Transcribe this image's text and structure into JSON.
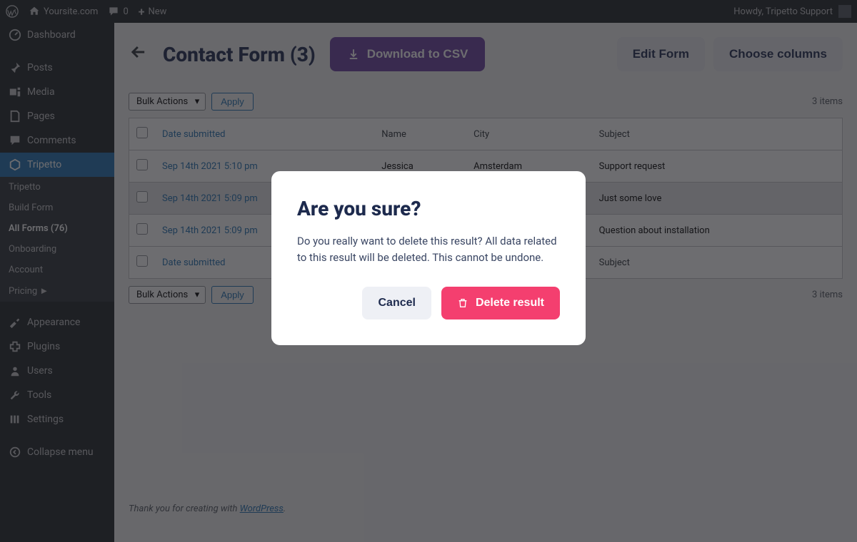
{
  "adminbar": {
    "site_name": "Yoursite.com",
    "comments_count": "0",
    "new_label": "New",
    "greeting": "Howdy, Tripetto Support"
  },
  "sidebar": {
    "items": [
      {
        "icon": "dashboard",
        "label": "Dashboard"
      },
      {
        "icon": "pin",
        "label": "Posts"
      },
      {
        "icon": "media",
        "label": "Media"
      },
      {
        "icon": "page",
        "label": "Pages"
      },
      {
        "icon": "comment",
        "label": "Comments"
      },
      {
        "icon": "tripetto",
        "label": "Tripetto",
        "active": true
      },
      {
        "icon": "appearance",
        "label": "Appearance"
      },
      {
        "icon": "plugin",
        "label": "Plugins"
      },
      {
        "icon": "users",
        "label": "Users"
      },
      {
        "icon": "tools",
        "label": "Tools"
      },
      {
        "icon": "settings",
        "label": "Settings"
      },
      {
        "icon": "collapse",
        "label": "Collapse menu"
      }
    ],
    "subitems": [
      {
        "label": "Tripetto"
      },
      {
        "label": "Build Form"
      },
      {
        "label": "All Forms (76)",
        "current": true
      },
      {
        "label": "Onboarding"
      },
      {
        "label": "Account"
      },
      {
        "label": "Pricing ►"
      }
    ]
  },
  "header": {
    "title": "Contact Form (3)",
    "download_label": "Download to CSV",
    "edit_label": "Edit Form",
    "columns_label": "Choose columns"
  },
  "toolbar": {
    "bulk_label": "Bulk Actions",
    "apply_label": "Apply",
    "items_count": "3 items"
  },
  "table": {
    "headers": [
      "Date submitted",
      "Name",
      "City",
      "Subject"
    ],
    "rows": [
      {
        "date": "Sep 14th 2021 5:10 pm",
        "name": "Jessica",
        "city": "Amsterdam",
        "subject": "Support request"
      },
      {
        "date": "Sep 14th 2021 5:09 pm",
        "name": "",
        "city": "",
        "subject": "Just some love",
        "highlighted": true
      },
      {
        "date": "Sep 14th 2021 5:09 pm",
        "name": "",
        "city": "",
        "subject": "Question about installation"
      }
    ]
  },
  "footer": {
    "prefix": "Thank you for creating with ",
    "link": "WordPress",
    "suffix": "."
  },
  "modal": {
    "title": "Are you sure?",
    "body": "Do you really want to delete this result? All data related to this result will be deleted. This cannot be undone.",
    "cancel_label": "Cancel",
    "delete_label": "Delete result"
  }
}
